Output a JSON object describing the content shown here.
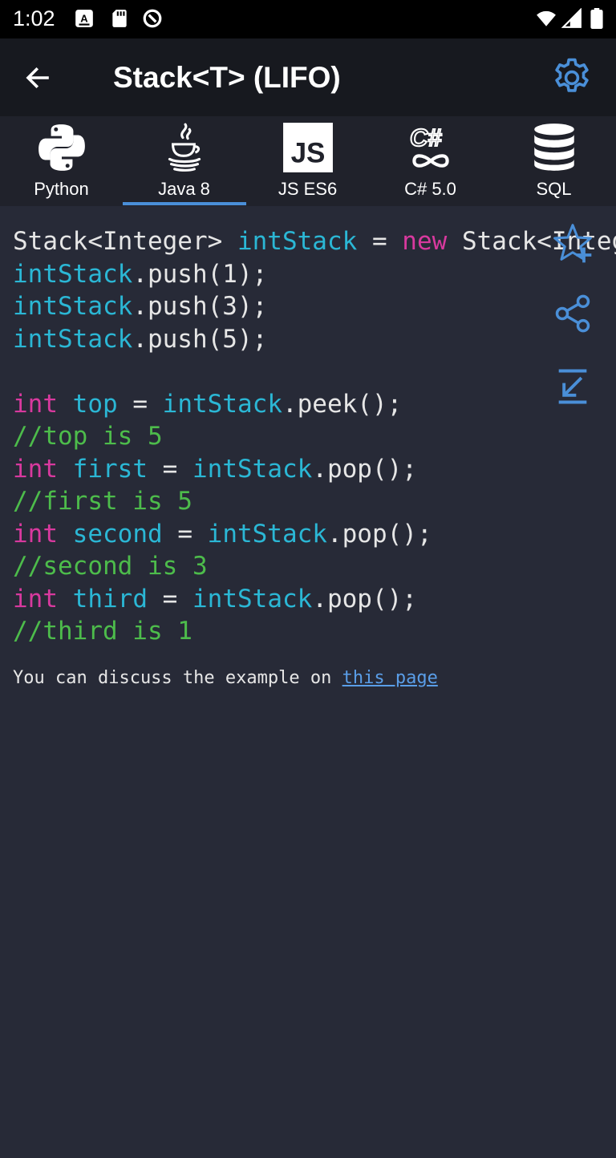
{
  "status_bar": {
    "time": "1:02",
    "left_icons": [
      "a-box-icon",
      "sd-card-icon",
      "at-sign-icon"
    ],
    "right_icons": [
      "wifi-icon",
      "cell-signal-icon",
      "battery-icon"
    ]
  },
  "app_bar": {
    "back_icon": "arrow-left-icon",
    "title": "Stack<T> (LIFO)",
    "settings_icon": "gear-icon",
    "accent": "#4a8fd8"
  },
  "tabs": [
    {
      "label": "Python",
      "icon": "python-logo-icon",
      "selected": false
    },
    {
      "label": "Java 8",
      "icon": "java-cup-icon",
      "selected": true
    },
    {
      "label": "JS ES6",
      "icon": "js-logo-icon",
      "selected": false
    },
    {
      "label": "C# 5.0",
      "icon": "csharp-logo-icon",
      "selected": false
    },
    {
      "label": "SQL",
      "icon": "database-icon",
      "selected": false
    }
  ],
  "code": {
    "colors": {
      "plain": "#e6e6e6",
      "variable": "#2bb7d5",
      "keyword": "#d8399e",
      "comment": "#4dbc4b",
      "background": "#272a37"
    },
    "lines": [
      [
        [
          "plain",
          "Stack<Integer> "
        ],
        [
          "var",
          "intStack"
        ],
        [
          "plain",
          " = "
        ],
        [
          "kw",
          "new"
        ],
        [
          "plain",
          " Stack<Integer>();"
        ]
      ],
      [
        [
          "var",
          "intStack"
        ],
        [
          "plain",
          ".push(1);"
        ]
      ],
      [
        [
          "var",
          "intStack"
        ],
        [
          "plain",
          ".push(3);"
        ]
      ],
      [
        [
          "var",
          "intStack"
        ],
        [
          "plain",
          ".push(5);"
        ]
      ],
      [],
      [
        [
          "kw",
          "int"
        ],
        [
          "plain",
          " "
        ],
        [
          "var",
          "top"
        ],
        [
          "plain",
          " = "
        ],
        [
          "var",
          "intStack"
        ],
        [
          "plain",
          ".peek();"
        ]
      ],
      [
        [
          "cm",
          "//top is 5"
        ]
      ],
      [
        [
          "kw",
          "int"
        ],
        [
          "plain",
          " "
        ],
        [
          "var",
          "first"
        ],
        [
          "plain",
          " = "
        ],
        [
          "var",
          "intStack"
        ],
        [
          "plain",
          ".pop();"
        ]
      ],
      [
        [
          "cm",
          "//first is 5"
        ]
      ],
      [
        [
          "kw",
          "int"
        ],
        [
          "plain",
          " "
        ],
        [
          "var",
          "second"
        ],
        [
          "plain",
          " = "
        ],
        [
          "var",
          "intStack"
        ],
        [
          "plain",
          ".pop();"
        ]
      ],
      [
        [
          "cm",
          "//second is 3"
        ]
      ],
      [
        [
          "kw",
          "int"
        ],
        [
          "plain",
          " "
        ],
        [
          "var",
          "third"
        ],
        [
          "plain",
          " = "
        ],
        [
          "var",
          "intStack"
        ],
        [
          "plain",
          ".pop();"
        ]
      ],
      [
        [
          "cm",
          "//third is 1"
        ]
      ]
    ]
  },
  "side_actions": [
    "star-add-icon",
    "share-icon",
    "collapse-icon"
  ],
  "discussion": {
    "text": "You can discuss the example on ",
    "link_text": "this page"
  }
}
